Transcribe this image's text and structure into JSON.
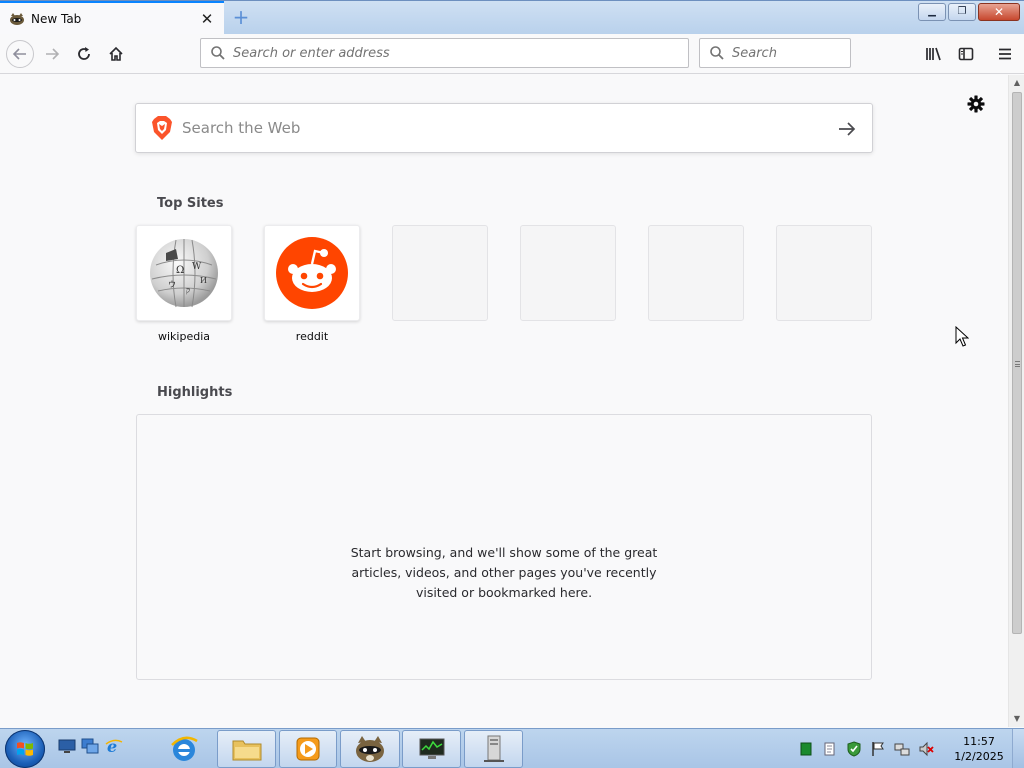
{
  "tab": {
    "title": "New Tab",
    "favicon": "raccoon-icon"
  },
  "window": {
    "minimize": "minimize-icon",
    "restore": "restore-icon",
    "close": "close-icon"
  },
  "nav": {
    "back": "back-arrow-icon",
    "forward": "forward-arrow-icon",
    "reload": "reload-icon",
    "home": "home-icon",
    "url_placeholder": "Search or enter address",
    "search_placeholder": "Search",
    "library": "library-icon",
    "sidebar": "sidebar-icon",
    "menu": "hamburger-menu-icon"
  },
  "page": {
    "web_search_placeholder": "Search the Web",
    "top_sites_title": "Top Sites",
    "top_sites": [
      {
        "label": "wikipedia",
        "icon": "wikipedia-globe-icon"
      },
      {
        "label": "reddit",
        "icon": "reddit-icon"
      },
      {
        "label": "",
        "icon": ""
      },
      {
        "label": "",
        "icon": ""
      },
      {
        "label": "",
        "icon": ""
      },
      {
        "label": "",
        "icon": ""
      }
    ],
    "highlights_title": "Highlights",
    "highlights_message": "Start browsing, and we'll show some of the great articles, videos, and other pages you've recently visited or bookmarked here."
  },
  "taskbar": {
    "clock_time": "11:57",
    "clock_date": "1/2/2025"
  },
  "colors": {
    "accent": "#0a84ff",
    "reddit": "#ff4500",
    "brave": "#fb542b"
  }
}
